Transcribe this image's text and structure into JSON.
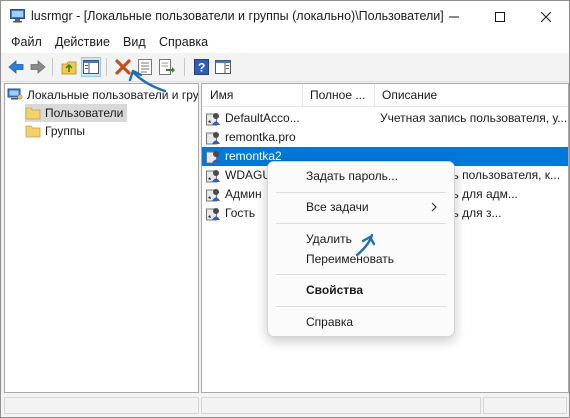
{
  "window": {
    "title": "lusrmgr - [Локальные пользователи и группы (локально)\\Пользователи]",
    "icon": "computer-users-icon",
    "controls": {
      "minimize": "minimize-icon",
      "maximize": "maximize-icon",
      "close": "close-icon"
    }
  },
  "menu": {
    "items": [
      "Файл",
      "Действие",
      "Вид",
      "Справка"
    ]
  },
  "toolbar": {
    "buttons": [
      "back-arrow-icon",
      "forward-arrow-icon",
      "up-folder-icon",
      "show-hide-tree-icon",
      "delete-icon",
      "properties-icon",
      "export-list-icon",
      "help-icon",
      "action-pane-icon"
    ]
  },
  "tree": {
    "root": "Локальные пользователи и гру",
    "children": [
      "Пользователи",
      "Группы"
    ],
    "selected": "Пользователи"
  },
  "list": {
    "columns": [
      "Имя",
      "Полное ...",
      "Описание"
    ],
    "rows": [
      {
        "name": "DefaultAcco...",
        "fullname": "",
        "description": "Учетная запись пользователя, у..."
      },
      {
        "name": "remontka.pro",
        "fullname": "",
        "description": ""
      },
      {
        "name": "remontka2",
        "fullname": "",
        "description": ""
      },
      {
        "name": "WDAGU",
        "fullname": "",
        "description": "четная запись пользователя, к..."
      },
      {
        "name": "Админ",
        "fullname": "",
        "description": "четная запись для адм..."
      },
      {
        "name": "Гость",
        "fullname": "",
        "description": "четная запись для з..."
      }
    ],
    "selected_row": "remontka2"
  },
  "context_menu": {
    "set_password": "Задать пароль...",
    "all_tasks": "Все задачи",
    "delete": "Удалить",
    "rename": "Переименовать",
    "properties": "Свойства",
    "help": "Справка"
  },
  "colors": {
    "selection": "#0078d7",
    "annotation": "#1f6fb0",
    "delete_icon": "#c0501e"
  }
}
